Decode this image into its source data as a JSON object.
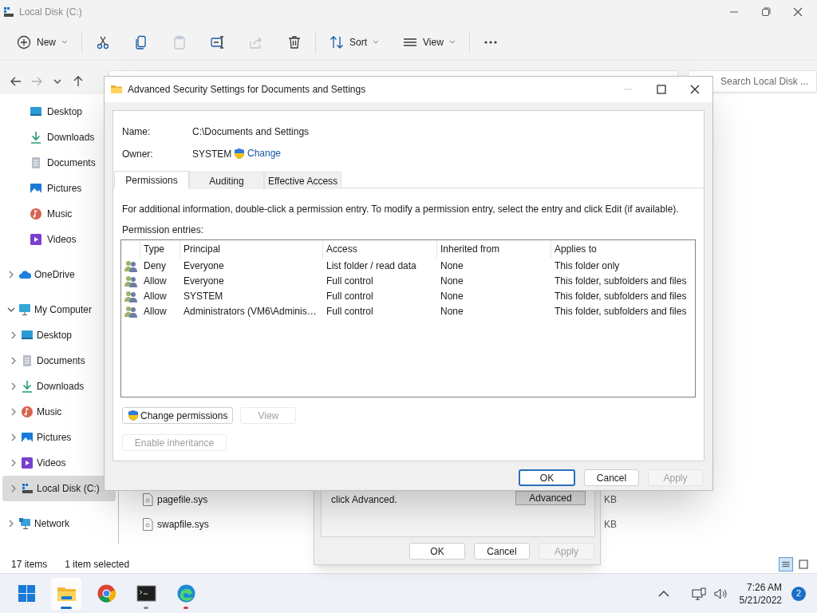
{
  "explorer": {
    "title": "Local Disk (C:)",
    "toolbar": [
      {
        "kind": "new",
        "label": "New",
        "dropdown": true,
        "disabled": false
      },
      {
        "kind": "cut",
        "disabled": false
      },
      {
        "kind": "copy",
        "disabled": false
      },
      {
        "kind": "paste",
        "disabled": true
      },
      {
        "kind": "rename",
        "disabled": false
      },
      {
        "kind": "share",
        "disabled": true
      },
      {
        "kind": "delete",
        "disabled": false
      },
      {
        "kind": "sort",
        "label": "Sort",
        "dropdown": true,
        "disabled": false
      },
      {
        "kind": "view",
        "label": "View",
        "dropdown": true,
        "disabled": false
      },
      {
        "kind": "more",
        "disabled": false
      }
    ],
    "nav": [
      {
        "kind": "back",
        "disabled": false
      },
      {
        "kind": "forward",
        "disabled": true
      },
      {
        "kind": "recent",
        "disabled": false
      },
      {
        "kind": "up",
        "disabled": false
      }
    ],
    "search": {
      "placeholder": "Search Local Disk ..."
    },
    "quick_access": [
      {
        "label": "Desktop",
        "kind": "desktop"
      },
      {
        "label": "Downloads",
        "kind": "downloads"
      },
      {
        "label": "Documents",
        "kind": "documents"
      },
      {
        "label": "Pictures",
        "kind": "pictures"
      },
      {
        "label": "Music",
        "kind": "music"
      },
      {
        "label": "Videos",
        "kind": "videos"
      }
    ],
    "tree": [
      {
        "label": "OneDrive",
        "kind": "cloud",
        "expanded": false,
        "selected": false
      },
      {
        "label": "My Computer",
        "kind": "computer",
        "expanded": true,
        "selected": false,
        "children": [
          {
            "label": "Desktop",
            "kind": "desktop",
            "expanded": false,
            "selected": false
          },
          {
            "label": "Documents",
            "kind": "documents",
            "expanded": false,
            "selected": false
          },
          {
            "label": "Downloads",
            "kind": "downloads",
            "expanded": false,
            "selected": false
          },
          {
            "label": "Music",
            "kind": "music",
            "expanded": false,
            "selected": false
          },
          {
            "label": "Pictures",
            "kind": "pictures",
            "expanded": false,
            "selected": false
          },
          {
            "label": "Videos",
            "kind": "videos",
            "expanded": false,
            "selected": false
          },
          {
            "label": "Local Disk (C:)",
            "kind": "disk",
            "expanded": false,
            "selected": true
          }
        ]
      },
      {
        "label": "Network",
        "kind": "network",
        "expanded": false,
        "selected": false
      }
    ],
    "files": [
      {
        "name": "pagefile.sys",
        "column_3": "KB"
      },
      {
        "name": "swapfile.sys",
        "column_3": "KB"
      }
    ],
    "status_bar": {
      "items": "17 items",
      "selection": "1 item selected"
    },
    "view_toggles": [
      {
        "kind": "details",
        "selected": true
      },
      {
        "kind": "tiles",
        "selected": false
      }
    ]
  },
  "properties_dialog": {
    "text": "click Advanced.",
    "advanced_button": "Advanced",
    "buttons": [
      {
        "label": "OK",
        "disabled": false
      },
      {
        "label": "Cancel",
        "disabled": false
      },
      {
        "label": "Apply",
        "disabled": true
      }
    ]
  },
  "security_dialog": {
    "title": "Advanced Security Settings for Documents and Settings",
    "name_label": "Name:",
    "name": "C:\\Documents and Settings",
    "owner_label": "Owner:",
    "owner": "SYSTEM",
    "change_link": "Change",
    "tabs": [
      {
        "label": "Permissions",
        "selected": true
      },
      {
        "label": "Auditing",
        "selected": false
      },
      {
        "label": "Effective Access",
        "selected": false
      }
    ],
    "info": "For additional information, double-click a permission entry. To modify a permission entry, select the entry and click Edit (if available).",
    "entries_label": "Permission entries:",
    "columns": [
      "Type",
      "Principal",
      "Access",
      "Inherited from",
      "Applies to"
    ],
    "rows": [
      [
        "Deny",
        "Everyone",
        "List folder / read data",
        "None",
        "This folder only"
      ],
      [
        "Allow",
        "Everyone",
        "Full control",
        "None",
        "This folder, subfolders and files"
      ],
      [
        "Allow",
        "SYSTEM",
        "Full control",
        "None",
        "This folder, subfolders and files"
      ],
      [
        "Allow",
        "Administrators (VM6\\Adminis…",
        "Full control",
        "None",
        "This folder, subfolders and files"
      ]
    ],
    "actions": [
      {
        "label": "Change permissions",
        "shield": true,
        "disabled": false
      },
      {
        "label": "View",
        "shield": false,
        "disabled": true
      },
      {
        "label": "Enable inheritance",
        "shield": false,
        "disabled": true
      }
    ],
    "buttons": [
      {
        "label": "OK",
        "default": true,
        "disabled": false
      },
      {
        "label": "Cancel",
        "default": false,
        "disabled": false
      },
      {
        "label": "Apply",
        "default": false,
        "disabled": true
      }
    ]
  },
  "taskbar": {
    "apps": [
      {
        "kind": "start",
        "running": false,
        "active": false,
        "alert": false
      },
      {
        "kind": "explorer",
        "running": true,
        "active": true,
        "alert": false
      },
      {
        "kind": "chrome",
        "running": false,
        "active": false,
        "alert": false
      },
      {
        "kind": "terminal",
        "running": true,
        "active": false,
        "alert": false
      },
      {
        "kind": "edge",
        "running": true,
        "active": false,
        "alert": true
      }
    ],
    "time": "7:26 AM",
    "date": "5/21/2022",
    "notifications": "2"
  }
}
